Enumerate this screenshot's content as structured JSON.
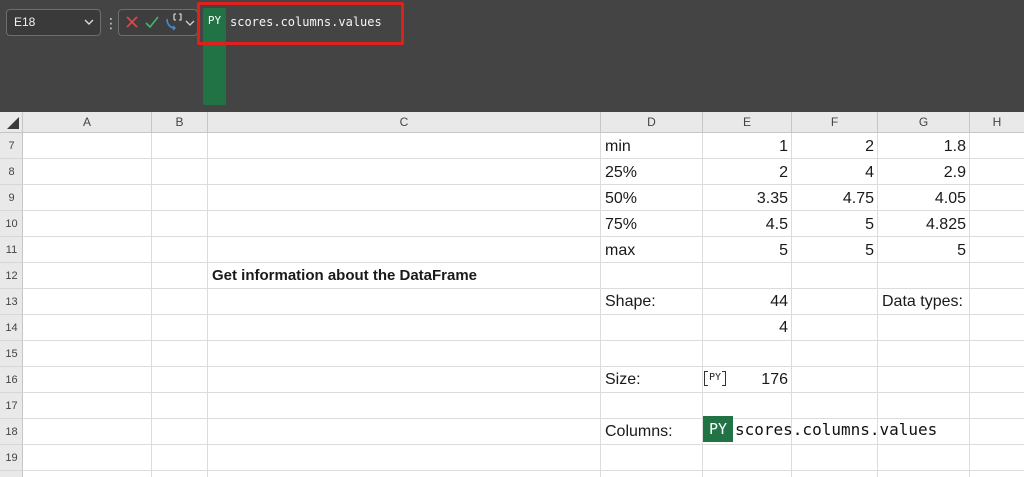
{
  "formula_bar": {
    "name_box": "E18",
    "name_box_chevron": "⌵",
    "more_dots": "⋮",
    "icons": {
      "cancel": "close-icon",
      "enter": "check-icon",
      "python_mode": "python-mode-icon"
    },
    "py_label": "PY",
    "formula": "scores.columns.values",
    "highlight_color": "#e0201c",
    "python_green": "#217346"
  },
  "columns": [
    "A",
    "B",
    "C",
    "D",
    "E",
    "F",
    "G",
    "H"
  ],
  "rows": [
    "7",
    "8",
    "9",
    "10",
    "11",
    "12",
    "13",
    "14",
    "15",
    "16",
    "17",
    "18",
    "19"
  ],
  "cells": {
    "D7": "min",
    "E7": "1",
    "F7": "2",
    "G7": "1.8",
    "D8": "25%",
    "E8": "2",
    "F8": "4",
    "G8": "2.9",
    "D9": "50%",
    "E9": "3.35",
    "F9": "4.75",
    "G9": "4.05",
    "D10": "75%",
    "E10": "4.5",
    "F10": "5",
    "G10": "4.825",
    "D11": "max",
    "E11": "5",
    "F11": "5",
    "G11": "5",
    "C12": "Get information about the DataFrame",
    "D13": "Shape:",
    "E13": "44",
    "G13": "Data types:",
    "E14": "4",
    "D16": "Size:",
    "E16": "176",
    "D18": "Columns:"
  },
  "py_badge_small": "PY",
  "active_cell": {
    "address": "E18",
    "badge": "PY",
    "text": "scores.columns.values"
  }
}
